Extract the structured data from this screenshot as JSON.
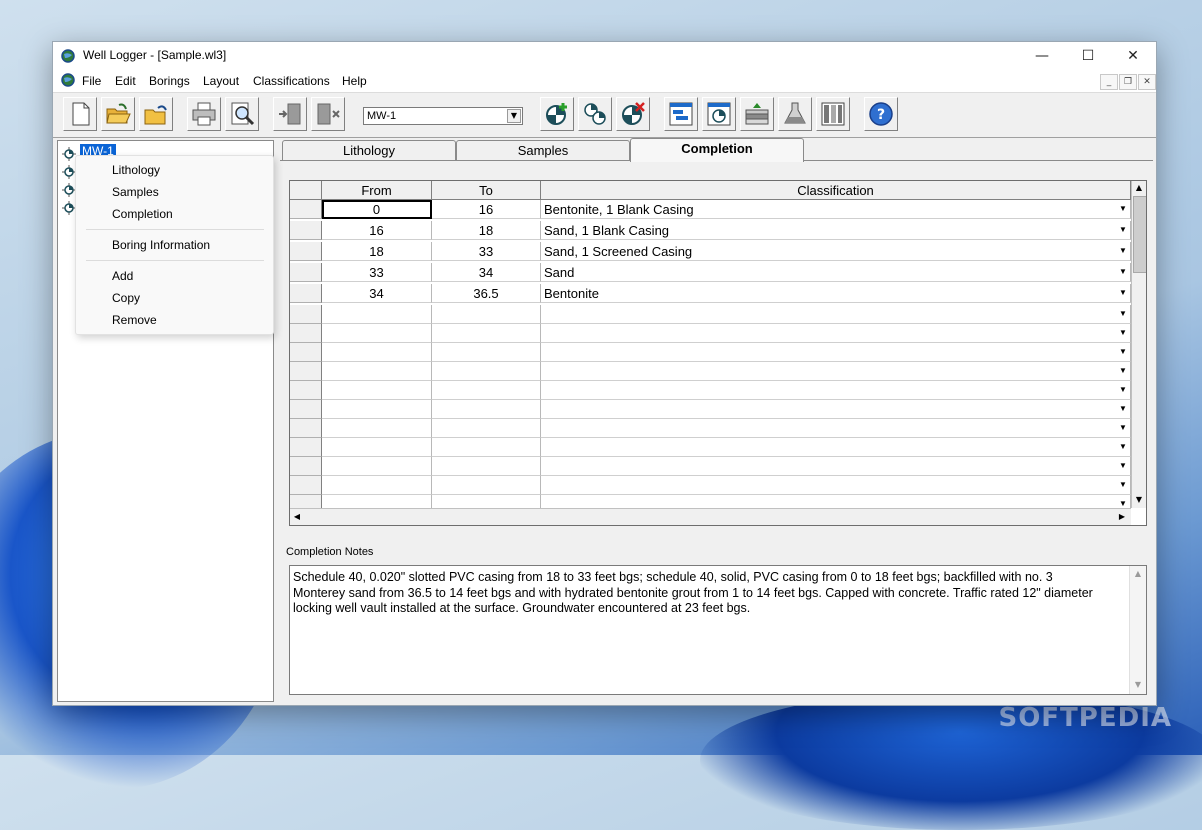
{
  "window": {
    "title": "Well Logger - [Sample.wl3]",
    "controls": {
      "minimize": "—",
      "maximize": "☐",
      "close": "✕"
    }
  },
  "menu": {
    "items": [
      "File",
      "Edit",
      "Borings",
      "Layout",
      "Classifications",
      "Help"
    ],
    "mdi_controls": {
      "minimize": "_",
      "restore": "❐",
      "close": "✕"
    }
  },
  "toolbar": {
    "boring_select": "MW-1",
    "buttons": [
      "new-doc-icon",
      "open-folder-icon",
      "open-recent-icon",
      "print-icon",
      "print-preview-icon",
      "insert-icon",
      "delete-icon",
      "add-boring-icon",
      "copy-boring-icon",
      "remove-boring-icon",
      "layout-icon",
      "boring-symbol-icon",
      "cross-section-icon",
      "lab-flask-icon",
      "columns-icon",
      "help-icon"
    ]
  },
  "tree": {
    "selected": "MW-1",
    "node_count": 4
  },
  "context_menu": {
    "items": [
      {
        "label": "Lithology"
      },
      {
        "label": "Samples"
      },
      {
        "label": "Completion"
      },
      {
        "label": "Boring Information"
      },
      {
        "label": "Add"
      },
      {
        "label": "Copy"
      },
      {
        "label": "Remove"
      }
    ]
  },
  "tabs": [
    "Lithology",
    "Samples",
    "Completion"
  ],
  "active_tab": "Completion",
  "grid": {
    "headers": [
      "From",
      "To",
      "Classification"
    ],
    "rows": [
      {
        "from": "0",
        "to": "16",
        "classification": "Bentonite, 1 Blank Casing"
      },
      {
        "from": "16",
        "to": "18",
        "classification": "Sand, 1 Blank Casing"
      },
      {
        "from": "18",
        "to": "33",
        "classification": "Sand, 1 Screened Casing"
      },
      {
        "from": "33",
        "to": "34",
        "classification": "Sand"
      },
      {
        "from": "34",
        "to": "36.5",
        "classification": "Bentonite"
      }
    ],
    "empty_rows": 11
  },
  "notes": {
    "label": "Completion Notes",
    "text": "Schedule 40, 0.020\" slotted PVC casing from 18 to 33 feet bgs; schedule 40, solid, PVC casing from 0 to 18 feet bgs; backfilled with no. 3 Monterey sand from 36.5 to 14 feet bgs and with hydrated bentonite grout from 1 to 14 feet bgs.  Capped with concrete.  Traffic rated 12\" diameter locking well vault installed at the surface.  Groundwater encountered at 23 feet bgs."
  },
  "watermark": "SOFTPEDIA",
  "colors": {
    "selection": "#0a64d6",
    "chrome": "#f0f0f0"
  }
}
